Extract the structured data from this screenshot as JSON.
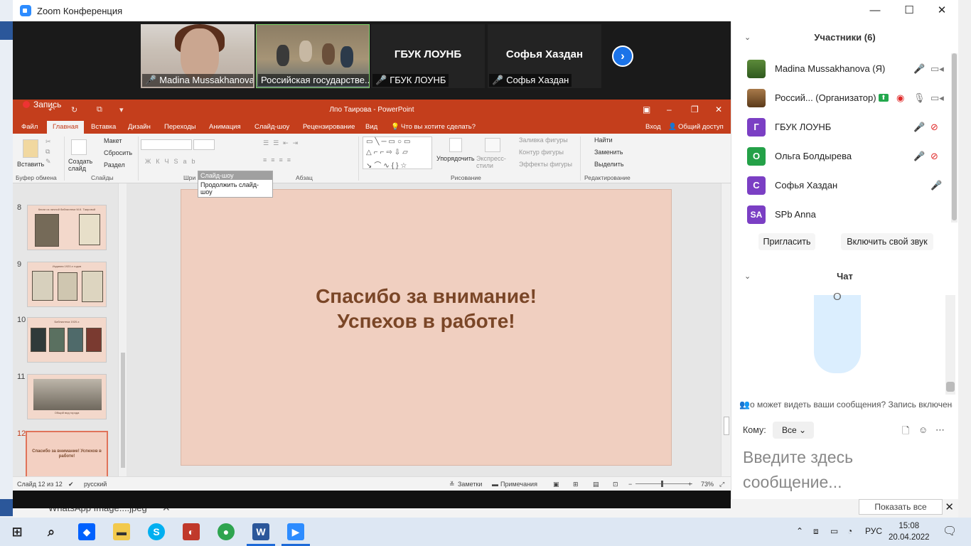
{
  "window": {
    "title": "Zoom Конференция",
    "minimize": "—",
    "maximize": "☐",
    "close": "✕"
  },
  "videos": [
    {
      "name": "Madina Mussakhanova",
      "muted": true
    },
    {
      "name": "Российская государстве...",
      "muted": false
    },
    {
      "name": "ГБУК ЛОУНБ",
      "big_name": "ГБУК ЛОУНБ",
      "muted": true
    },
    {
      "name": "Софья Хаздан",
      "big_name": "Софья Хаздан",
      "muted": true
    }
  ],
  "next_arrow": "›",
  "recording": "Запись",
  "powerpoint": {
    "doc_title": "Лпо Таирова - PowerPoint",
    "tabs": [
      "Файл",
      "Главная",
      "Вставка",
      "Дизайн",
      "Переходы",
      "Анимация",
      "Слайд-шоу",
      "Рецензирование",
      "Вид"
    ],
    "tell_me": "Что вы хотите сделать?",
    "login": "Вход",
    "share": "Общий доступ",
    "ribbon": {
      "paste": "Вставить",
      "clipboard": "Буфер обмена",
      "new_slide": "Создать слайд",
      "layout": "Макет",
      "reset": "Сбросить",
      "section": "Раздел",
      "slides": "Слайды",
      "font_group": "Шри",
      "paragraph": "Абзац",
      "arrange": "Упорядочить",
      "quick_styles": "Экспресс-стили",
      "fill": "Заливка фигуры",
      "outline": "Контур фигуры",
      "effects": "Эффекты фигуры",
      "drawing": "Рисование",
      "find": "Найти",
      "replace": "Заменить",
      "select": "Выделить",
      "editing": "Редактирование"
    },
    "tooltip": {
      "header": "Слайд-шоу",
      "body": "Продолжить слайд-шоу"
    },
    "thumbnails": [
      {
        "num": "8",
        "title": "Книги из личной библиотеки М.К. Таировой"
      },
      {
        "num": "9",
        "title": "Издания 1920-х годов"
      },
      {
        "num": "10",
        "title": "Библиотека 1920-х"
      },
      {
        "num": "11",
        "title": "Общий вид города"
      },
      {
        "num": "12",
        "title": "Спасибо за внимание! Успехов в работе!",
        "selected": true
      }
    ],
    "slide": {
      "line1": "Спасибо за внимание!",
      "line2": "Успехов в работе!"
    },
    "status": {
      "slide_of": "Слайд 12 из 12",
      "language": "русский",
      "notes": "Заметки",
      "comments": "Примечания",
      "zoom": "73%"
    }
  },
  "panel": {
    "participants_title": "Участники (6)",
    "participants": [
      {
        "name": "Madina Mussakhanova (Я)",
        "avatar": "",
        "color": "#5c8a3a"
      },
      {
        "name": "Россий... (Организатор)",
        "avatar": "",
        "color": "#8a5a2a"
      },
      {
        "name": "ГБУК ЛОУНБ",
        "avatar": "Г",
        "color": "#7b3fc4"
      },
      {
        "name": "Ольга Болдырева",
        "avatar": "О",
        "color": "#24a148"
      },
      {
        "name": "Софья Хаздан",
        "avatar": "С",
        "color": "#7b3fc4"
      },
      {
        "name": "SPb Anna",
        "avatar": "SA",
        "color": "#7b3fc4"
      }
    ],
    "invite": "Пригласить",
    "unmute": "Включить свой звук",
    "chat_title": "Чат",
    "notice": "о может видеть ваши сообщения? Запись включена",
    "to_label": "Кому:",
    "to_value": "Все",
    "input_placeholder": "Введите здесь сообщение..."
  },
  "background": {
    "taskbar_item": "WhatsApp Image....jpeg",
    "show_all": "Показать все"
  },
  "taskbar": {
    "language": "РУС",
    "time": "15:08",
    "date": "20.04.2022"
  }
}
